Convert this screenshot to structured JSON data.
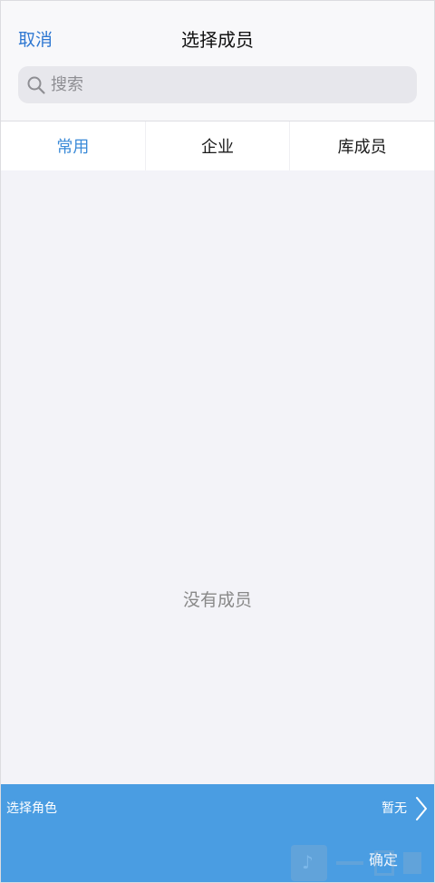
{
  "header": {
    "cancel_label": "取消",
    "title": "选择成员"
  },
  "search": {
    "placeholder": "搜索",
    "value": ""
  },
  "tabs": [
    {
      "label": "常用",
      "active": true
    },
    {
      "label": "企业",
      "active": false
    },
    {
      "label": "库成员",
      "active": false
    }
  ],
  "main": {
    "empty_text": "没有成员"
  },
  "footer": {
    "role_label": "选择角色",
    "role_value": "暂无",
    "confirm_label": "确定"
  },
  "colors": {
    "accent": "#2f78d2",
    "active_tab": "#3a8ad8",
    "footer_background": "#4a9de2",
    "page_background": "#f3f3f8"
  },
  "icons": {
    "search": "search-icon",
    "chevron": "chevron-right-icon"
  }
}
